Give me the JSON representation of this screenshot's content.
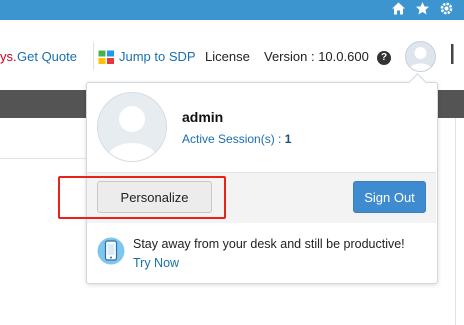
{
  "topbar": {
    "icons": [
      "home-icon",
      "star-icon",
      "gear-icon"
    ]
  },
  "header": {
    "trial_text": "ys.",
    "get_quote": "Get Quote",
    "jump_to_sdp": "Jump to SDP",
    "license": "License",
    "version": "Version : 10.0.600",
    "help_glyph": "?"
  },
  "profile_popup": {
    "username": "admin",
    "active_sessions_label": "Active Session(s) :",
    "active_sessions_count": "1",
    "personalize_label": "Personalize",
    "sign_out_label": "Sign Out",
    "promo_text": "Stay away from your desk and still be productive!",
    "promo_link": "Try Now"
  },
  "colors": {
    "topbar": "#3c95cf",
    "link": "#1a6fb0",
    "sign_out_button": "#3f8bd0",
    "highlight_box": "#e8211b",
    "dark_bar": "#545454"
  }
}
